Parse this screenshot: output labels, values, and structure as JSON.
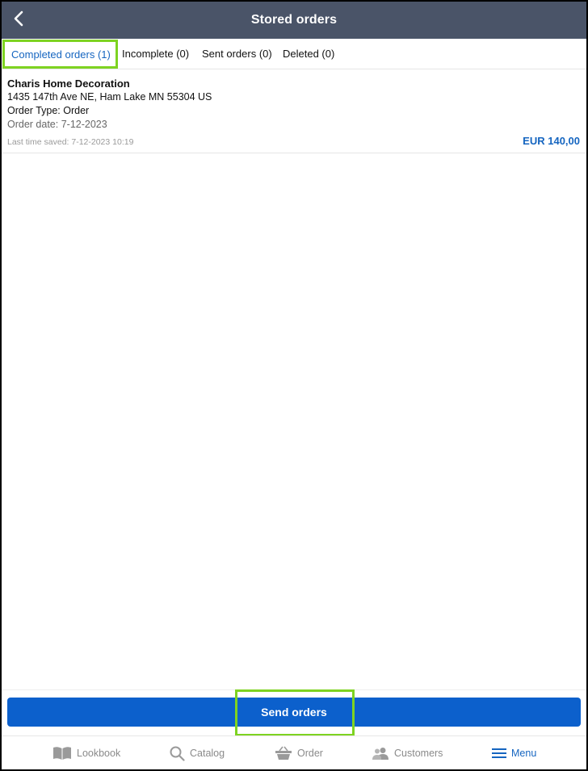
{
  "header": {
    "title": "Stored orders",
    "back_icon": "chevron-left-icon"
  },
  "tabs": [
    {
      "label": "Completed orders (1)",
      "active": true
    },
    {
      "label": "Incomplete (0)",
      "active": false
    },
    {
      "label": "Sent orders (0)",
      "active": false
    },
    {
      "label": "Deleted (0)",
      "active": false
    }
  ],
  "orders": [
    {
      "customer": "Charis Home Decoration",
      "address": "1435 147th Ave NE, Ham Lake MN 55304 US",
      "order_type": "Order Type: Order",
      "order_date": "Order date: 7-12-2023",
      "last_saved": "Last time saved: 7-12-2023 10:19",
      "amount": "EUR 140,00"
    }
  ],
  "actions": {
    "send_orders": "Send orders"
  },
  "bottom_nav": [
    {
      "label": "Lookbook",
      "icon": "book-icon",
      "active": false
    },
    {
      "label": "Catalog",
      "icon": "search-icon",
      "active": false
    },
    {
      "label": "Order",
      "icon": "basket-icon",
      "active": false
    },
    {
      "label": "Customers",
      "icon": "people-icon",
      "active": false
    },
    {
      "label": "Menu",
      "icon": "hamburger-menu-icon",
      "active": true
    }
  ],
  "colors": {
    "header_bg": "#4a5468",
    "accent": "#1565c0",
    "button": "#0c60cc",
    "highlight": "#7ed321"
  }
}
